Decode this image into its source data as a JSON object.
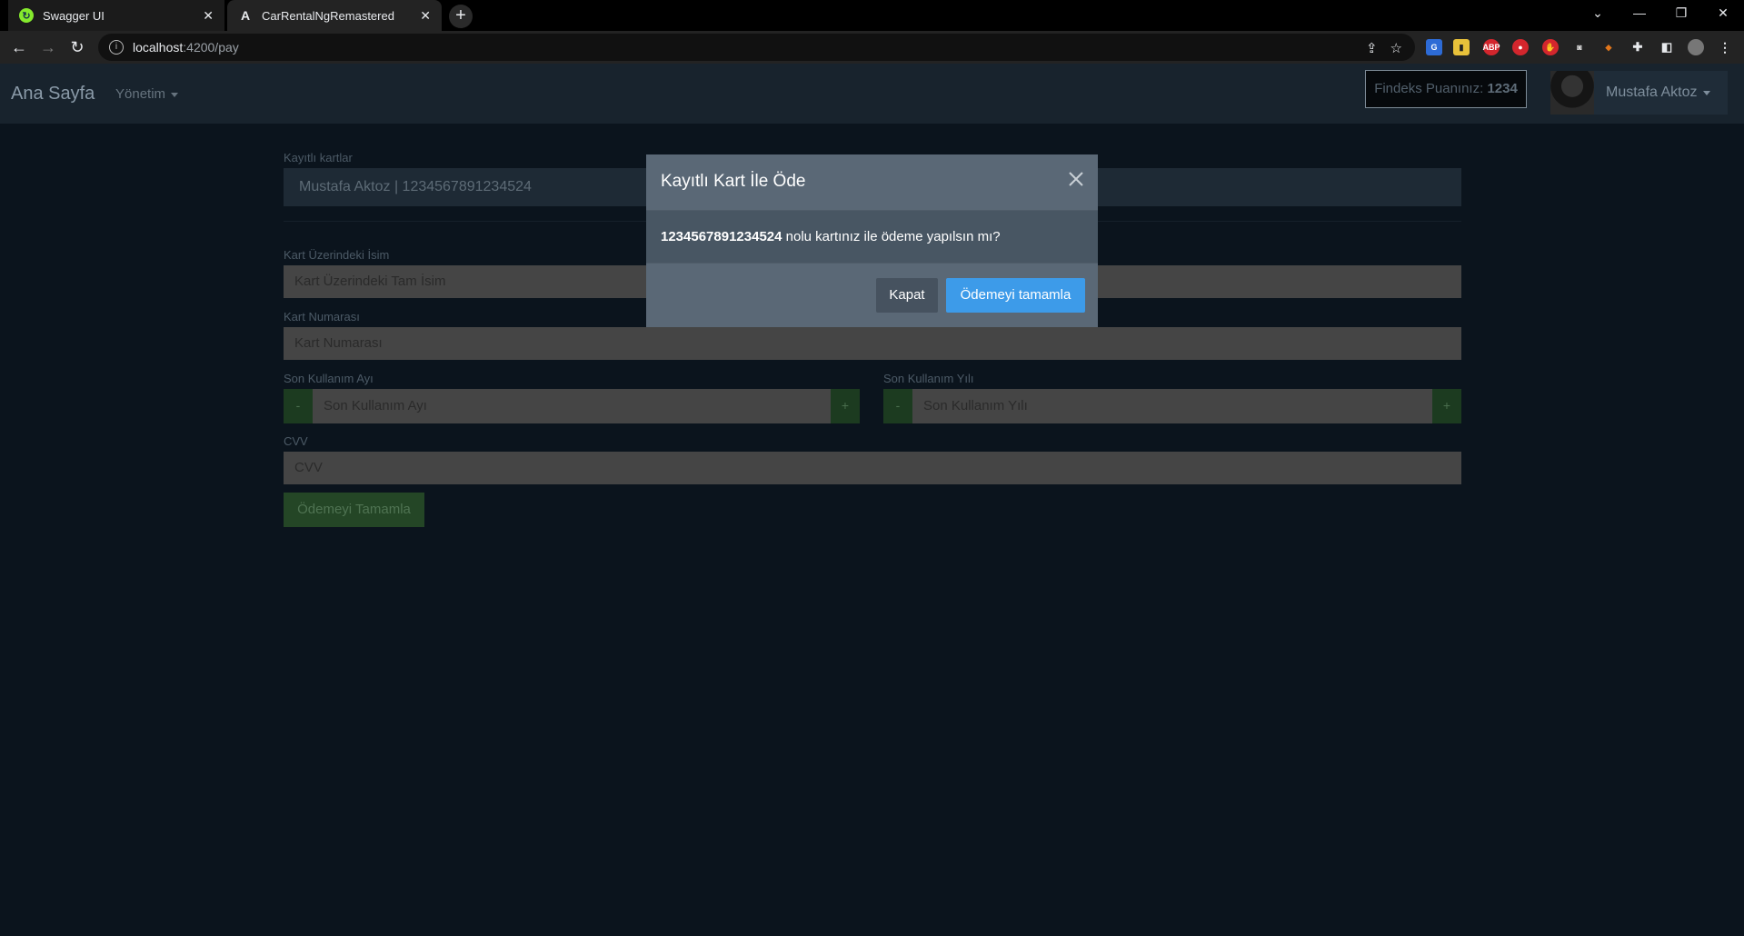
{
  "browser": {
    "tabs": [
      {
        "title": "Swagger UI",
        "active": false,
        "favicon": "swagger-icon"
      },
      {
        "title": "CarRentalNgRemastered",
        "active": true,
        "favicon": "angular-icon"
      }
    ],
    "url_host": "localhost",
    "url_path": ":4200/pay"
  },
  "navbar": {
    "brand": "Ana Sayfa",
    "menu_label": "Yönetim",
    "findeks_label": "Findeks Puanınız:",
    "findeks_value": "1234",
    "user_name": "Mustafa Aktoz"
  },
  "form": {
    "saved_cards_label": "Kayıtlı kartlar",
    "saved_card_selected": "Mustafa Aktoz | 1234567891234524",
    "name_label": "Kart Üzerindeki İsim",
    "name_placeholder": "Kart Üzerindeki Tam İsim",
    "number_label": "Kart Numarası",
    "number_placeholder": "Kart Numarası",
    "month_label": "Son Kullanım Ayı",
    "month_placeholder": "Son Kullanım Ayı",
    "year_label": "Son Kullanım Yılı",
    "year_placeholder": "Son Kullanım Yılı",
    "cvv_label": "CVV",
    "cvv_placeholder": "CVV",
    "minus": "-",
    "plus": "+",
    "submit_label": "Ödemeyi Tamamla"
  },
  "modal": {
    "title": "Kayıtlı Kart İle Öde",
    "card_number": "1234567891234524",
    "message": " nolu kartınız ile ödeme yapılsın mı?",
    "close_label": "Kapat",
    "confirm_label": "Ödemeyi tamamla"
  },
  "colors": {
    "page_bg": "#0b141d",
    "modal_bg": "#5a6876",
    "primary": "#3d9be9",
    "success": "#244626"
  }
}
